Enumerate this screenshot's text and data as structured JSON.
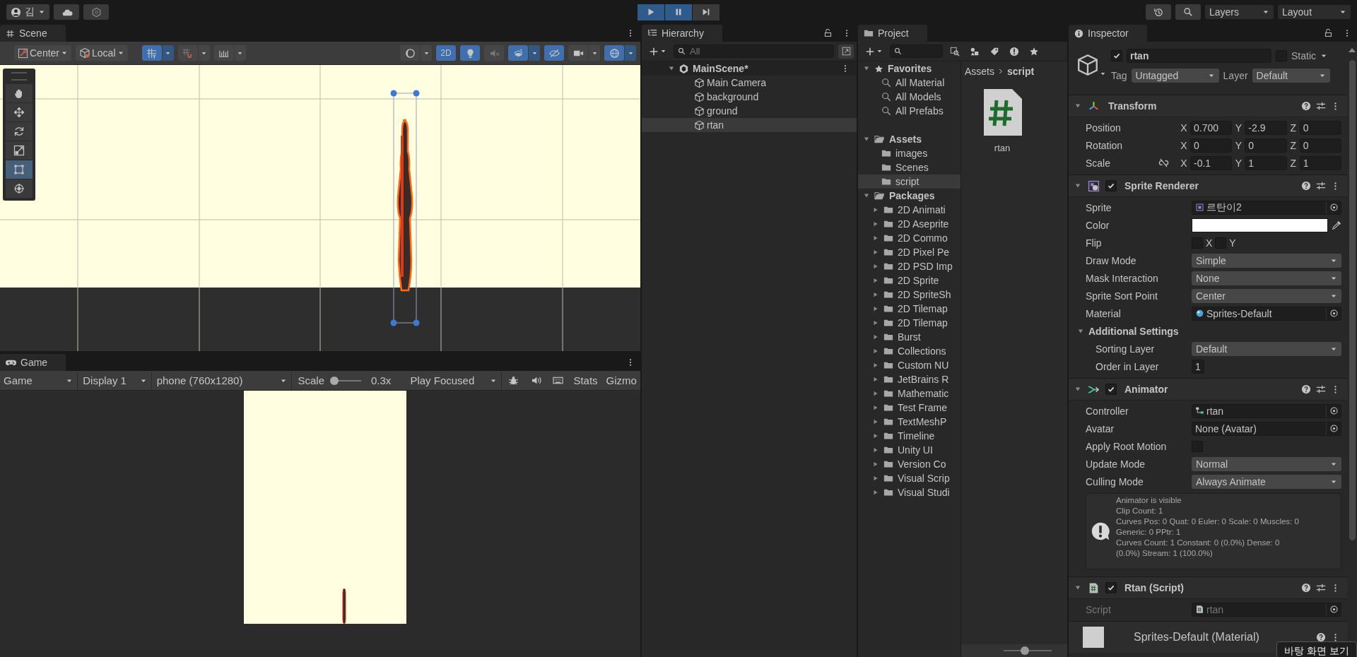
{
  "top_bar": {
    "account": "김",
    "play_controls": [
      {
        "kind": "play",
        "on": true
      },
      {
        "kind": "pause",
        "on": true
      },
      {
        "kind": "step",
        "on": false
      }
    ],
    "layers": "Layers",
    "layout": "Layout"
  },
  "scene": {
    "tab": "Scene",
    "pivot": "Center",
    "space": "Local",
    "snap_toggles": [
      {
        "kind": "grid",
        "on": true
      },
      {
        "kind": "snap",
        "on": false
      },
      {
        "kind": "increment",
        "on": false
      }
    ],
    "view_toggles": [
      {
        "kind": "shading",
        "on": false
      },
      {
        "kind": "mode2d",
        "label": "2D",
        "on": true
      },
      {
        "kind": "lighting",
        "on": true
      },
      {
        "kind": "audio",
        "on": false
      },
      {
        "kind": "effects",
        "on": true
      },
      {
        "kind": "visibility",
        "on": true
      },
      {
        "kind": "camera",
        "on": false
      },
      {
        "kind": "gizmos",
        "on": true
      }
    ],
    "tools": [
      {
        "kind": "hand",
        "selected": false
      },
      {
        "kind": "move",
        "selected": false
      },
      {
        "kind": "rotate",
        "selected": false
      },
      {
        "kind": "scale",
        "selected": false
      },
      {
        "kind": "rect",
        "selected": true
      },
      {
        "kind": "transform",
        "selected": false
      }
    ]
  },
  "game": {
    "tab": "Game",
    "view": "Game",
    "display": "Display 1",
    "resolution": "phone (760x1280)",
    "scale_label": "Scale",
    "scale": {
      "level": 0.12
    },
    "scale_reading": "0.3x",
    "play_mode": "Play Focused",
    "stats": "Stats",
    "gizmos": "Gizmo"
  },
  "hierarchy": {
    "tab": "Hierarchy",
    "search_placeholder": "All",
    "scene": "MainScene*",
    "scene_expanded": true,
    "objects": [
      {
        "name": "Main Camera",
        "selected": false
      },
      {
        "name": "background",
        "selected": false
      },
      {
        "name": "ground",
        "selected": false
      },
      {
        "name": "rtan",
        "selected": true
      }
    ]
  },
  "project": {
    "tab": "Project",
    "favorites": {
      "label": "Favorites",
      "expanded": true,
      "items": [
        "All Material",
        "All Models",
        "All Prefabs"
      ]
    },
    "assets": {
      "label": "Assets",
      "expanded": true,
      "children": [
        {
          "name": "images",
          "selected": false
        },
        {
          "name": "Scenes",
          "selected": false
        },
        {
          "name": "script",
          "selected": true
        }
      ]
    },
    "packages": {
      "label": "Packages",
      "expanded": true,
      "children": [
        {
          "name": "2D Animati",
          "expanded": false
        },
        {
          "name": "2D Aseprite",
          "expanded": false
        },
        {
          "name": "2D Commo",
          "expanded": false
        },
        {
          "name": "2D Pixel Pe",
          "expanded": false
        },
        {
          "name": "2D PSD Imp",
          "expanded": false
        },
        {
          "name": "2D Sprite",
          "expanded": false
        },
        {
          "name": "2D SpriteSh",
          "expanded": false
        },
        {
          "name": "2D Tilemap",
          "expanded": false
        },
        {
          "name": "2D Tilemap",
          "expanded": false
        },
        {
          "name": "Burst",
          "expanded": false
        },
        {
          "name": "Collections",
          "expanded": false
        },
        {
          "name": "Custom NU",
          "expanded": false
        },
        {
          "name": "JetBrains R",
          "expanded": false
        },
        {
          "name": "Mathematic",
          "expanded": false
        },
        {
          "name": "Test Frame",
          "expanded": false
        },
        {
          "name": "TextMeshP",
          "expanded": false
        },
        {
          "name": "Timeline",
          "expanded": false
        },
        {
          "name": "Unity UI",
          "expanded": false
        },
        {
          "name": "Version Co",
          "expanded": false
        },
        {
          "name": "Visual Scrip",
          "expanded": false
        },
        {
          "name": "Visual Studi",
          "expanded": false
        }
      ]
    },
    "breadcrumb": [
      "Assets",
      "script"
    ],
    "files": [
      {
        "name": "rtan",
        "kind": "script"
      }
    ],
    "icon_size": {
      "level": 0.45
    }
  },
  "inspector": {
    "tab": "Inspector",
    "object": {
      "active": true,
      "name": "rtan",
      "static": false,
      "static_label": "Static",
      "tag_label": "Tag",
      "tag": "Untagged",
      "layer_label": "Layer",
      "layer": "Default"
    },
    "components": [
      {
        "kind": "transform",
        "title": "Transform",
        "expanded": true,
        "rows": [
          {
            "label": "Position",
            "values": [
              {
                "axis": "X",
                "value": "0.700"
              },
              {
                "axis": "Y",
                "value": "-2.9"
              },
              {
                "axis": "Z",
                "value": "0"
              }
            ]
          },
          {
            "label": "Rotation",
            "values": [
              {
                "axis": "X",
                "value": "0"
              },
              {
                "axis": "Y",
                "value": "0"
              },
              {
                "axis": "Z",
                "value": "0"
              }
            ]
          },
          {
            "label": "Scale",
            "constrained": false,
            "values": [
              {
                "axis": "X",
                "value": "-0.1"
              },
              {
                "axis": "Y",
                "value": "1"
              },
              {
                "axis": "Z",
                "value": "1"
              }
            ]
          }
        ]
      },
      {
        "kind": "sprite_renderer",
        "title": "Sprite Renderer",
        "enabled": true,
        "expanded": true,
        "fields": [
          {
            "kind": "sprite_field",
            "label": "Sprite",
            "value": "르탄이2"
          },
          {
            "kind": "color",
            "label": "Color",
            "color": "#ffffff"
          },
          {
            "kind": "flip",
            "label": "Flip",
            "options": [
              {
                "label": "X",
                "checked": false
              },
              {
                "label": "Y",
                "checked": false
              }
            ]
          },
          {
            "kind": "dropdown",
            "label": "Draw Mode",
            "value": "Simple"
          },
          {
            "kind": "dropdown",
            "label": "Mask Interaction",
            "value": "None"
          },
          {
            "kind": "dropdown",
            "label": "Sprite Sort Point",
            "value": "Center"
          },
          {
            "kind": "material_field",
            "label": "Material",
            "value": "Sprites-Default"
          },
          {
            "kind": "foldout",
            "label": "Additional Settings",
            "expanded": true,
            "children": [
              {
                "kind": "dropdown",
                "label": "Sorting Layer",
                "value": "Default"
              },
              {
                "kind": "text",
                "label": "Order in Layer",
                "value": "1"
              }
            ]
          }
        ]
      },
      {
        "kind": "animator",
        "title": "Animator",
        "enabled": true,
        "expanded": true,
        "fields": [
          {
            "kind": "controller_field",
            "label": "Controller",
            "value": "rtan"
          },
          {
            "kind": "object",
            "label": "Avatar",
            "value": "None (Avatar)"
          },
          {
            "kind": "checkbox",
            "label": "Apply Root Motion",
            "checked": false
          },
          {
            "kind": "dropdown",
            "label": "Update Mode",
            "value": "Normal"
          },
          {
            "kind": "dropdown",
            "label": "Culling Mode",
            "value": "Always Animate"
          },
          {
            "kind": "info",
            "lines": [
              "Animator is visible",
              "Clip Count: 1",
              "Curves Pos: 0 Quat: 0 Euler: 0 Scale: 0 Muscles: 0",
              "Generic: 0 PPtr: 1",
              "Curves Count: 1 Constant: 0 (0.0%) Dense: 0",
              "(0.0%) Stream: 1 (100.0%)"
            ]
          }
        ]
      },
      {
        "kind": "script",
        "title": "Rtan (Script)",
        "enabled": true,
        "expanded": true,
        "fields": [
          {
            "kind": "script_field",
            "label": "Script",
            "value": "rtan",
            "disabled": true
          }
        ]
      },
      {
        "kind": "material",
        "title": "Sprites-Default (Material)"
      }
    ]
  },
  "tooltip": "바탕 화면 보기"
}
